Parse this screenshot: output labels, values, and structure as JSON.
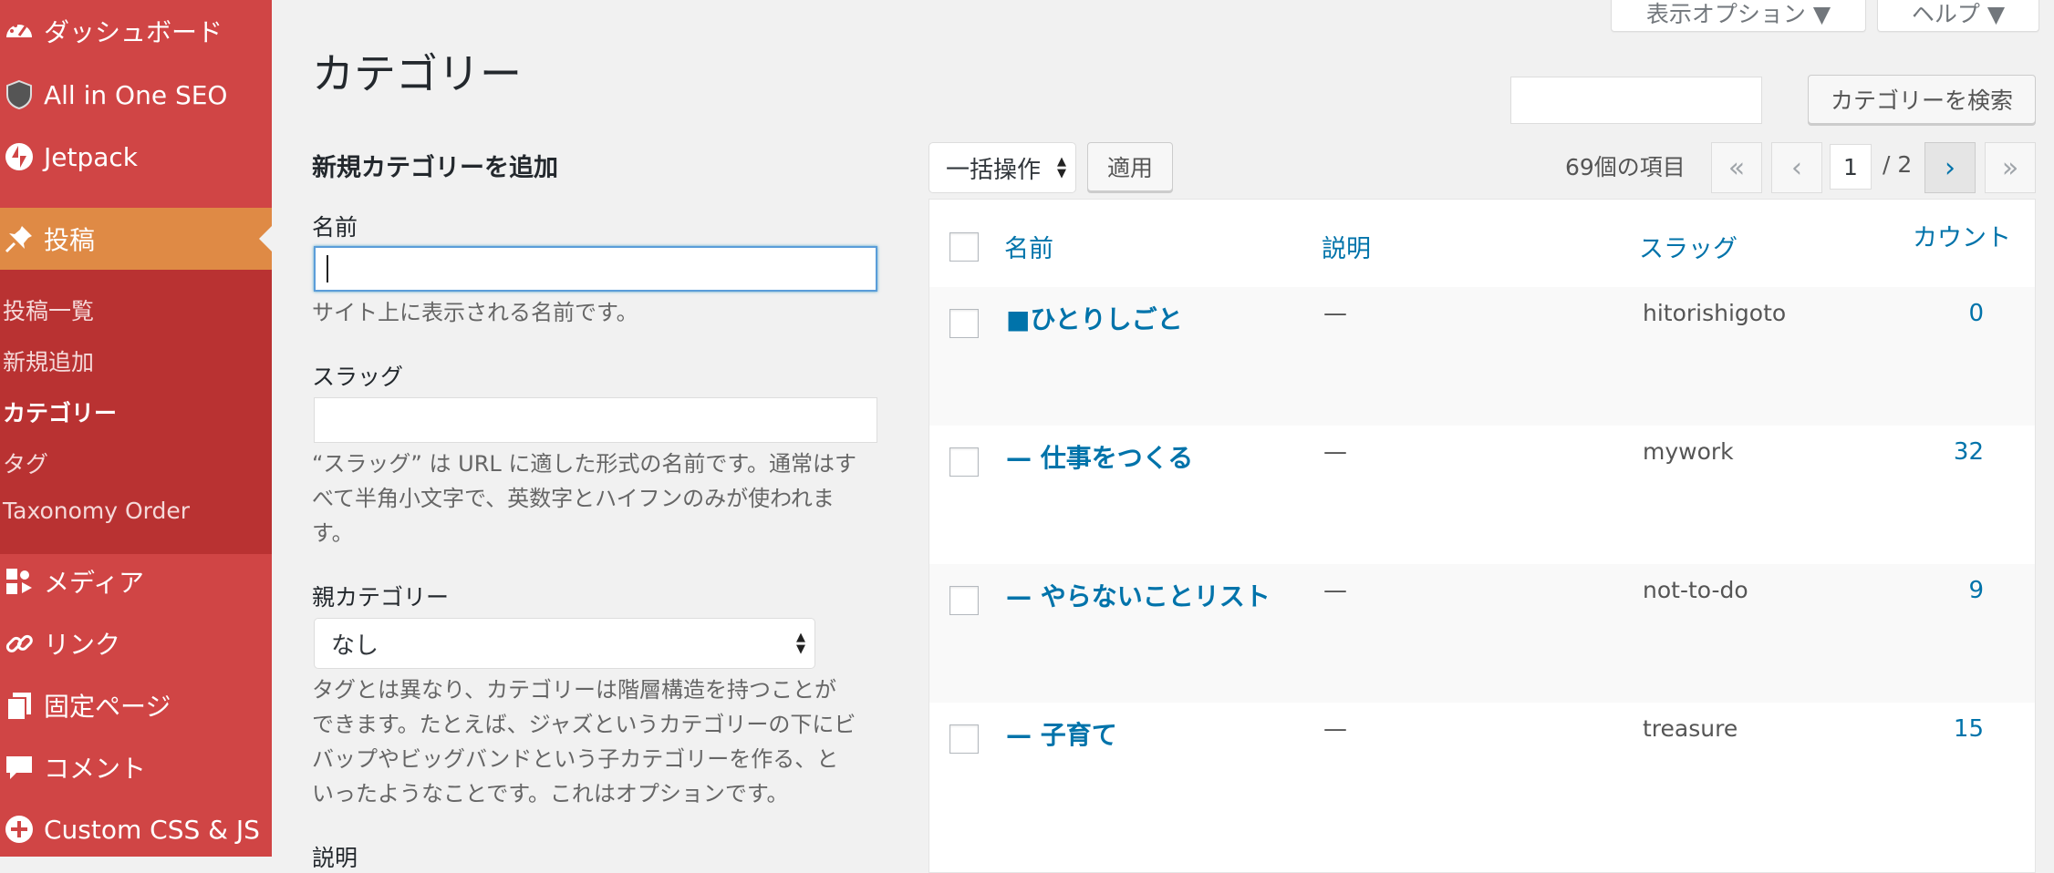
{
  "sidebar": {
    "menu": [
      {
        "label": "ダッシュボード",
        "icon": "dashboard-icon"
      },
      {
        "label": "All in One SEO",
        "icon": "shield-icon"
      },
      {
        "label": "Jetpack",
        "icon": "jetpack-icon"
      },
      {
        "label": "投稿",
        "icon": "pin-icon"
      },
      {
        "label": "メディア",
        "icon": "media-icon"
      },
      {
        "label": "リンク",
        "icon": "link-icon"
      },
      {
        "label": "固定ページ",
        "icon": "pages-icon"
      },
      {
        "label": "コメント",
        "icon": "comment-icon"
      },
      {
        "label": "Custom CSS & JS",
        "icon": "plus-circle-icon"
      }
    ],
    "submenu": [
      "投稿一覧",
      "新規追加",
      "カテゴリー",
      "タグ",
      "Taxonomy Order"
    ]
  },
  "top": {
    "screen_options": "表示オプション ▼",
    "help": "ヘルプ ▼"
  },
  "page": {
    "title": "カテゴリー",
    "search_button": "カテゴリーを検索"
  },
  "form": {
    "heading": "新規カテゴリーを追加",
    "name_label": "名前",
    "name_desc": "サイト上に表示される名前です。",
    "slug_label": "スラッグ",
    "slug_desc_lines": [
      "“スラッグ” は URL に適した形式の名前です。通常はす",
      "べて半角小文字で、英数字とハイフンのみが使われま",
      "す。"
    ],
    "parent_label": "親カテゴリー",
    "parent_value": "なし",
    "parent_desc_lines": [
      "タグとは異なり、カテゴリーは階層構造を持つことが",
      "できます。たとえば、ジャズというカテゴリーの下にビ",
      "バップやビッグバンドという子カテゴリーを作る、と",
      "いったようなことです。これはオプションです。"
    ],
    "description_label": "説明"
  },
  "tablenav": {
    "bulk_action": "一括操作",
    "apply": "適用",
    "items_count": "69個の項目",
    "first": "«",
    "prev": "‹",
    "current_page": "1",
    "total_pages": "/ 2",
    "next": "›",
    "last": "»"
  },
  "table": {
    "headers": {
      "name": "名前",
      "description": "説明",
      "slug": "スラッグ",
      "count": "カウント"
    },
    "rows": [
      {
        "name": "■ひとりしごと",
        "description": "—",
        "slug": "hitorishigoto",
        "count": "0"
      },
      {
        "name": "— 仕事をつくる",
        "description": "—",
        "slug": "mywork",
        "count": "32"
      },
      {
        "name": "— やらないことリスト",
        "description": "—",
        "slug": "not-to-do",
        "count": "9"
      },
      {
        "name": "— 子育て",
        "description": "—",
        "slug": "treasure",
        "count": "15"
      }
    ]
  },
  "colors": {
    "sidebar": "#d04545",
    "sidebar_active": "#df8a45",
    "submenu": "#b93232",
    "link": "#0073aa"
  }
}
